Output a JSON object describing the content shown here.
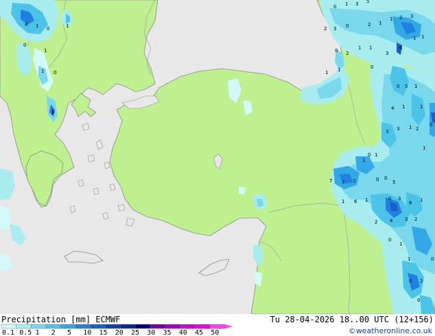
{
  "title": "Precipitation [mm] ECMWF",
  "valid_time": "Tu 28-04-2026 18..00 UTC (12+156)",
  "credit": "©weatheronline.co.uk",
  "colors": {
    "sea": "#e8e8e8",
    "land": "#bff090",
    "coast": "#8a8a8a",
    "border": "#a0a0a0",
    "precip": [
      "#d2fafa",
      "#a8ecf0",
      "#7ad8ec",
      "#4cc4e8",
      "#32a8e6",
      "#2080e0",
      "#1860c8",
      "#1040b0",
      "#082898",
      "#000080",
      "#7000b0",
      "#a000c8",
      "#d000d8",
      "#f000e8",
      "#ff40f0"
    ]
  },
  "legend": {
    "labels": [
      "0.1",
      "0.5",
      "1",
      "2",
      "5",
      "10",
      "15",
      "20",
      "25",
      "30",
      "35",
      "40",
      "45",
      "50"
    ]
  },
  "values": [
    {
      "t": "0"
    },
    {
      "t": "1"
    },
    {
      "t": "3"
    },
    {
      "t": "5"
    },
    {
      "t": "4"
    },
    {
      "t": "1"
    },
    {
      "t": "0"
    },
    {
      "t": "1"
    },
    {
      "t": "0"
    },
    {
      "t": "1"
    },
    {
      "t": "1"
    },
    {
      "t": "0"
    },
    {
      "t": "2"
    },
    {
      "t": "3"
    },
    {
      "t": "0"
    },
    {
      "t": "2"
    },
    {
      "t": "1"
    },
    {
      "t": "1"
    },
    {
      "t": "2"
    },
    {
      "t": "3"
    },
    {
      "t": "1"
    },
    {
      "t": "0"
    },
    {
      "t": "6"
    },
    {
      "t": "1"
    },
    {
      "t": "3"
    },
    {
      "t": "2"
    },
    {
      "t": "1"
    },
    {
      "t": "1"
    },
    {
      "t": "1"
    },
    {
      "t": "1"
    },
    {
      "t": "0"
    },
    {
      "t": "0"
    },
    {
      "t": "5"
    },
    {
      "t": "1"
    },
    {
      "t": "1"
    },
    {
      "t": "4"
    },
    {
      "t": "3"
    },
    {
      "t": "3"
    },
    {
      "t": "1"
    },
    {
      "t": "2"
    },
    {
      "t": "7"
    },
    {
      "t": "7"
    },
    {
      "t": "2"
    },
    {
      "t": "0"
    },
    {
      "t": "1"
    },
    {
      "t": "1"
    },
    {
      "t": "1"
    },
    {
      "t": "6"
    },
    {
      "t": "1"
    },
    {
      "t": "0"
    },
    {
      "t": "3"
    },
    {
      "t": "2"
    },
    {
      "t": "4"
    },
    {
      "t": "3"
    },
    {
      "t": "2"
    },
    {
      "t": "1"
    },
    {
      "t": "1"
    },
    {
      "t": "0"
    },
    {
      "t": "0"
    },
    {
      "t": "1"
    },
    {
      "t": "0"
    },
    {
      "t": "1"
    },
    {
      "t": "0"
    },
    {
      "t": "2"
    },
    {
      "t": "0"
    },
    {
      "t": "6"
    },
    {
      "t": "1"
    },
    {
      "t": "5"
    },
    {
      "t": "0"
    },
    {
      "t": "0"
    }
  ]
}
